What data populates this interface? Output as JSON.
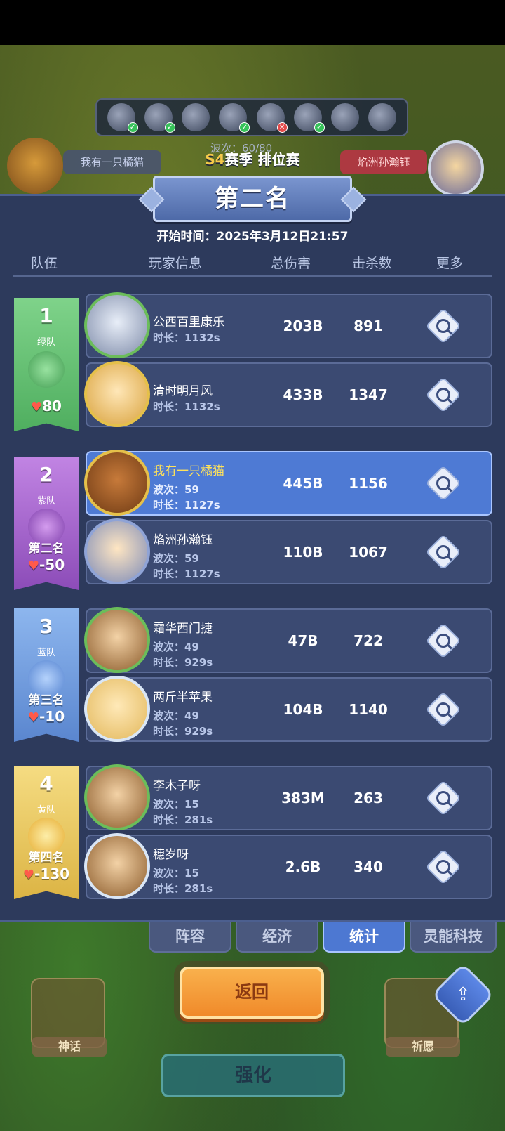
{
  "background": {
    "wave_text": "波次：60/80",
    "left_player": "我有一只橘猫",
    "right_player": "焰洲孙瀚钰",
    "icons": [
      "leaf-icon",
      "spider-icon",
      "snowflake-icon",
      "skull-icon",
      "bone-icon",
      "swirl-icon",
      "fire-icon",
      "ghost-icon"
    ]
  },
  "header": {
    "season_tag": "S4",
    "season_title": "赛季 排位赛",
    "rank_title": "第二名",
    "start_time": "开始时间：2025年3月12日21:57"
  },
  "columns": {
    "team": "队伍",
    "player": "玩家信息",
    "damage": "总伤害",
    "kills": "击杀数",
    "more": "更多"
  },
  "teams": [
    {
      "num": "1",
      "name": "绿队",
      "rank": "",
      "hp": "80",
      "color": "#5fbf6f",
      "players": [
        {
          "name": "公西百里康乐",
          "wave": "",
          "duration": "时长：1132s",
          "damage": "203B",
          "kills": "891"
        },
        {
          "name": "清时明月风",
          "wave": "",
          "duration": "时长：1132s",
          "damage": "433B",
          "kills": "1347"
        }
      ]
    },
    {
      "num": "2",
      "name": "紫队",
      "rank": "第二名",
      "hp": "-50",
      "color": "#a866cc",
      "players": [
        {
          "name": "我有一只橘猫",
          "wave": "波次：59",
          "duration": "时长：1127s",
          "damage": "445B",
          "kills": "1156"
        },
        {
          "name": "焰洲孙瀚钰",
          "wave": "波次：59",
          "duration": "时长：1127s",
          "damage": "110B",
          "kills": "1067"
        }
      ]
    },
    {
      "num": "3",
      "name": "蓝队",
      "rank": "第三名",
      "hp": "-10",
      "color": "#5a8ed6",
      "players": [
        {
          "name": "霜华西门捷",
          "wave": "波次：49",
          "duration": "时长：929s",
          "damage": "47B",
          "kills": "722"
        },
        {
          "name": "两斤半苹果",
          "wave": "波次：49",
          "duration": "时长：929s",
          "damage": "104B",
          "kills": "1140"
        }
      ]
    },
    {
      "num": "4",
      "name": "黄队",
      "rank": "第四名",
      "hp": "-130",
      "color": "#e6c24a",
      "players": [
        {
          "name": "李木子呀",
          "wave": "波次：15",
          "duration": "时长：281s",
          "damage": "383M",
          "kills": "263"
        },
        {
          "name": "穗岁呀",
          "wave": "波次：15",
          "duration": "时长：281s",
          "damage": "2.6B",
          "kills": "340"
        }
      ]
    }
  ],
  "tabs": [
    "阵容",
    "经济",
    "统计",
    "灵能科技"
  ],
  "active_tab": "统计",
  "buttons": {
    "back": "返回",
    "myth": "神话",
    "wish": "祈愿",
    "enhance": "强化"
  }
}
